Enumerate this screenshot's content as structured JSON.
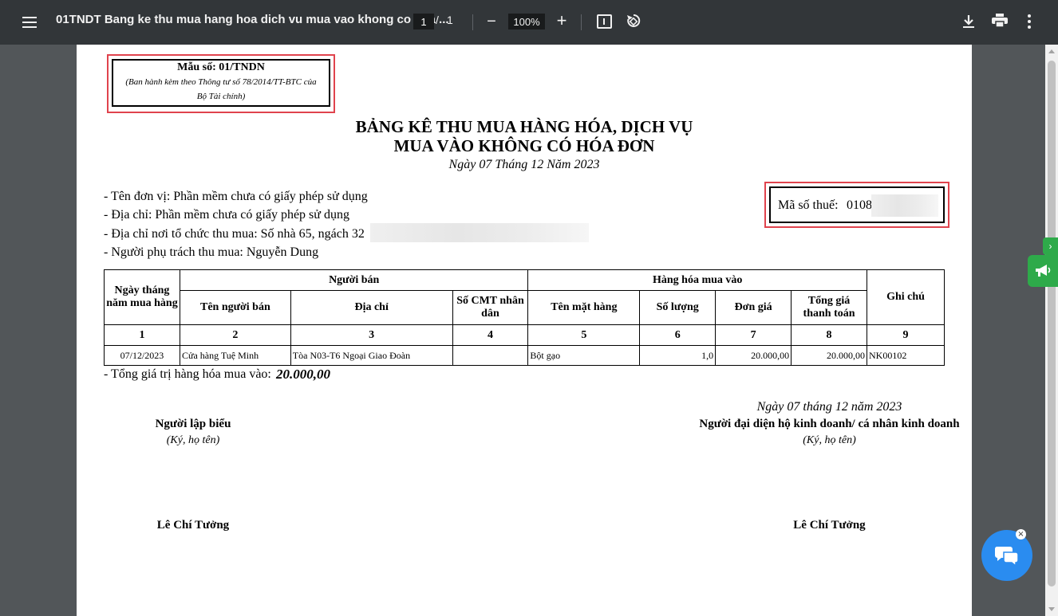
{
  "viewer": {
    "title": "01TNDT Bang ke thu mua hang hoa dich vu mua vao khong co hoa ...",
    "page_current": "1",
    "page_sep": "/",
    "page_total": "1",
    "zoom": "100%",
    "zoom_minus": "−",
    "zoom_plus": "+"
  },
  "form": {
    "form_no": "Mẫu số: 01/TNDN",
    "issued_line1": "(Ban hành kèm theo Thông tư số 78/2014/TT-BTC của",
    "issued_line2": "Bộ Tài chính)",
    "title_line1": "BẢNG KÊ THU MUA HÀNG HÓA, DỊCH VỤ",
    "title_line2": "MUA VÀO KHÔNG CÓ HÓA ĐƠN",
    "date": "Ngày 07 Tháng 12 Năm 2023",
    "unit": "- Tên đơn vị: Phần mềm chưa có giấy phép sử dụng",
    "address": "- Địa chỉ: Phần mềm chưa có giấy phép sử dụng",
    "purchase_place": "- Địa chỉ nơi tổ chức thu mua: Số nhà 65, ngách 32",
    "person": "- Người phụ trách thu mua: Nguyễn Dung",
    "tax_code_label": "Mã số thuế:",
    "tax_code_value": "0108"
  },
  "table": {
    "col_date": "Ngày tháng năm mua hàng",
    "group_seller": "Người bán",
    "group_goods": "Hàng hóa mua vào",
    "col_note": "Ghi chú",
    "col_seller_name": "Tên người bán",
    "col_address": "Địa chỉ",
    "col_id": "Số CMT nhân dân",
    "col_item": "Tên mặt hàng",
    "col_qty": "Số lượng",
    "col_price": "Đơn giá",
    "col_total": "Tổng giá thanh toán",
    "numbers": [
      "1",
      "2",
      "3",
      "4",
      "5",
      "6",
      "7",
      "8",
      "9"
    ],
    "rows": [
      {
        "date": "07/12/2023",
        "seller": "Cửa hàng Tuệ Minh",
        "address": "Tòa N03-T6 Ngoại Giao Đoàn",
        "id": "",
        "item": "Bột gạo",
        "qty": "1,0",
        "price": "20.000,00",
        "total": "20.000,00",
        "note": "NK00102"
      }
    ]
  },
  "summary": {
    "label": "- Tổng giá trị hàng hóa mua vào:",
    "value": "20.000,00"
  },
  "signatures": {
    "date": "Ngày 07 tháng 12 năm 2023",
    "left_title": "Người lập biểu",
    "left_sub": "(Ký, họ tên)",
    "left_name": "Lê Chí Tưởng",
    "right_title": "Người đại diện hộ kinh doanh/ cá nhân kinh doanh",
    "right_sub": "(Ký, họ tên)",
    "right_name": "Lê Chí Tưởng"
  },
  "colors": {
    "toolbar": "#323639",
    "backdrop": "#525659",
    "highlight": "#e0434d",
    "widget_green": "#2eaa4a",
    "chat_blue": "#2a8cf0"
  }
}
